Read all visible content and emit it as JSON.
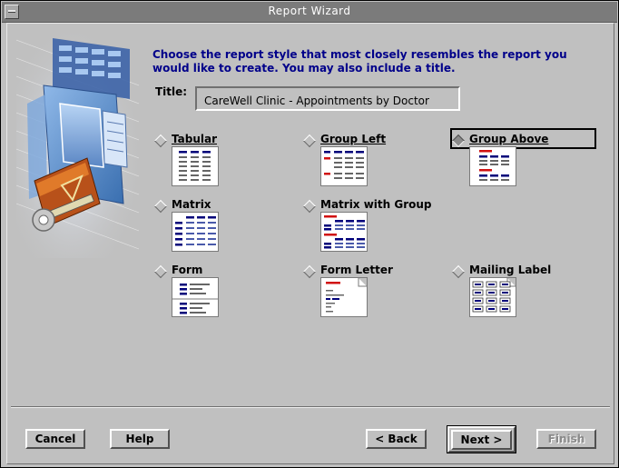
{
  "window": {
    "title": "Report Wizard"
  },
  "instructions": "Choose the report style that most closely resembles the report you would like to create. You may also include a title.",
  "title_field": {
    "label": "Title:",
    "value": "CareWell Clinic - Appointments by Doctor"
  },
  "styles": {
    "selected": "Group Above",
    "options": [
      {
        "label": "Tabular"
      },
      {
        "label": "Group Left"
      },
      {
        "label": "Group Above"
      },
      {
        "label": "Matrix"
      },
      {
        "label": "Matrix with Group"
      },
      {
        "label": "Form"
      },
      {
        "label": "Form Letter"
      },
      {
        "label": "Mailing Label"
      }
    ]
  },
  "buttons": {
    "cancel": "Cancel",
    "help": "Help",
    "back": "< Back",
    "next": "Next >",
    "finish": "Finish"
  },
  "colors": {
    "instruction_text": "#00008a",
    "thumb_navy": "#00007a",
    "thumb_red": "#d01010"
  }
}
